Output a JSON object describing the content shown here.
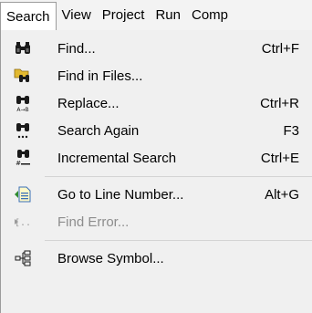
{
  "menubar": {
    "items": [
      {
        "label": "Search"
      },
      {
        "label": "View"
      },
      {
        "label": "Project"
      },
      {
        "label": "Run"
      },
      {
        "label": "Comp"
      }
    ]
  },
  "menu": {
    "items": [
      {
        "label": "Find...",
        "shortcut": "Ctrl+F",
        "icon": "binoculars-icon"
      },
      {
        "label": "Find in Files...",
        "shortcut": "",
        "icon": "find-in-files-icon"
      },
      {
        "label": "Replace...",
        "shortcut": "Ctrl+R",
        "icon": "replace-icon"
      },
      {
        "label": "Search Again",
        "shortcut": "F3",
        "icon": "search-again-icon"
      },
      {
        "label": "Incremental Search",
        "shortcut": "Ctrl+E",
        "icon": "incremental-search-icon"
      },
      {
        "label": "Go to Line Number...",
        "shortcut": "Alt+G",
        "icon": "goto-line-icon"
      },
      {
        "label": "Find Error...",
        "shortcut": "",
        "icon": "find-error-icon",
        "disabled": true
      },
      {
        "label": "Browse Symbol...",
        "shortcut": "",
        "icon": "browse-symbol-icon"
      }
    ]
  }
}
